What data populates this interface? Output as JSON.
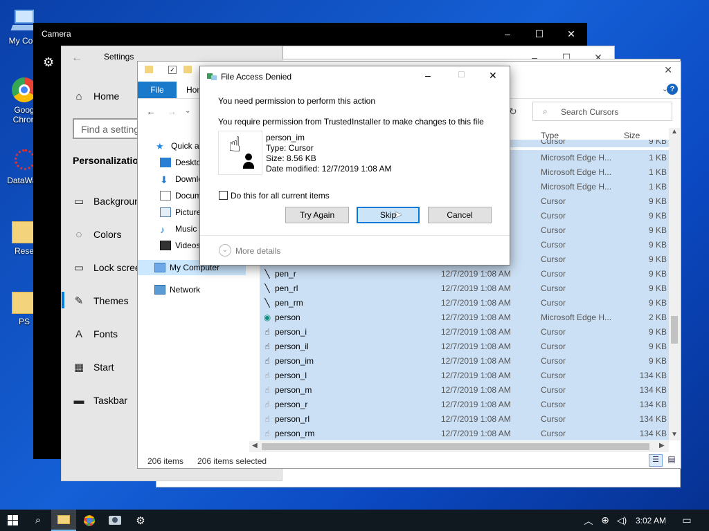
{
  "desktop": {
    "icons": [
      {
        "label": "My Com",
        "icon": "computer-icon"
      },
      {
        "label": "Goog Chron",
        "icon": "chrome-icon"
      },
      {
        "label": "DataWag",
        "icon": "datawag-icon"
      },
      {
        "label": "Rese",
        "icon": "folder-icon"
      },
      {
        "label": "PS",
        "icon": "folder-icon"
      }
    ]
  },
  "camera": {
    "title": "Camera",
    "controls": [
      "–",
      "☐",
      "✕"
    ]
  },
  "settings": {
    "title": "Settings",
    "home": "Home",
    "search_placeholder": "Find a setting",
    "section": "Personalization",
    "items": [
      "Background",
      "Colors",
      "Lock screen",
      "Themes",
      "Fonts",
      "Start",
      "Taskbar"
    ],
    "active_item": "Themes"
  },
  "explorer": {
    "ribbon_tabs": [
      "File",
      "Hom"
    ],
    "search_placeholder": "Search Cursors",
    "columns": {
      "type": "Type",
      "size": "Size"
    },
    "nav": [
      {
        "label": "Quick ac",
        "icon": "star-icon"
      },
      {
        "label": "Deskto",
        "icon": "desktop-icon"
      },
      {
        "label": "Downlo",
        "icon": "download-icon"
      },
      {
        "label": "Docum",
        "icon": "document-icon"
      },
      {
        "label": "Picture",
        "icon": "pictures-icon"
      },
      {
        "label": "Music",
        "icon": "music-icon"
      },
      {
        "label": "Videos",
        "icon": "videos-icon"
      },
      {
        "label": "My Computer",
        "icon": "computer-icon"
      },
      {
        "label": "Network",
        "icon": "network-icon"
      }
    ],
    "partial_rows": [
      {
        "type": "Cursor",
        "size": "9 KB"
      },
      {
        "type": "Microsoft Edge H...",
        "size": "1 KB"
      },
      {
        "type": "Microsoft Edge H...",
        "size": "1 KB"
      },
      {
        "type": "Microsoft Edge H...",
        "size": "1 KB"
      },
      {
        "type": "Cursor",
        "size": "9 KB"
      },
      {
        "type": "Cursor",
        "size": "9 KB"
      },
      {
        "type": "Cursor",
        "size": "9 KB"
      },
      {
        "type": "Cursor",
        "size": "9 KB"
      },
      {
        "type": "Cursor",
        "size": "9 KB"
      }
    ],
    "rows": [
      {
        "name": "pen_r",
        "date": "12/7/2019 1:08 AM",
        "type": "Cursor",
        "size": "9 KB",
        "glyph": "╲"
      },
      {
        "name": "pen_rl",
        "date": "12/7/2019 1:08 AM",
        "type": "Cursor",
        "size": "9 KB",
        "glyph": "╲"
      },
      {
        "name": "pen_rm",
        "date": "12/7/2019 1:08 AM",
        "type": "Cursor",
        "size": "9 KB",
        "glyph": "╲"
      },
      {
        "name": "person",
        "date": "12/7/2019 1:08 AM",
        "type": "Microsoft Edge H...",
        "size": "2 KB",
        "glyph": "◉"
      },
      {
        "name": "person_i",
        "date": "12/7/2019 1:08 AM",
        "type": "Cursor",
        "size": "9 KB",
        "glyph": "☝"
      },
      {
        "name": "person_il",
        "date": "12/7/2019 1:08 AM",
        "type": "Cursor",
        "size": "9 KB",
        "glyph": "☝"
      },
      {
        "name": "person_im",
        "date": "12/7/2019 1:08 AM",
        "type": "Cursor",
        "size": "9 KB",
        "glyph": "☝"
      },
      {
        "name": "person_l",
        "date": "12/7/2019 1:08 AM",
        "type": "Cursor",
        "size": "134 KB",
        "glyph": "☝"
      },
      {
        "name": "person_m",
        "date": "12/7/2019 1:08 AM",
        "type": "Cursor",
        "size": "134 KB",
        "glyph": "☝"
      },
      {
        "name": "person_r",
        "date": "12/7/2019 1:08 AM",
        "type": "Cursor",
        "size": "134 KB",
        "glyph": "☝"
      },
      {
        "name": "person_rl",
        "date": "12/7/2019 1:08 AM",
        "type": "Cursor",
        "size": "134 KB",
        "glyph": "☝"
      },
      {
        "name": "person_rm",
        "date": "12/7/2019 1:08 AM",
        "type": "Cursor",
        "size": "134 KB",
        "glyph": "☝"
      }
    ],
    "status": {
      "items": "206 items",
      "selected": "206 items selected"
    }
  },
  "dialog": {
    "title": "File Access Denied",
    "heading": "You need permission to perform this action",
    "message": "You require permission from TrustedInstaller to make changes to this file",
    "file": {
      "name": "person_im",
      "type": "Type: Cursor",
      "size": "Size: 8.56 KB",
      "modified": "Date modified: 12/7/2019 1:08 AM"
    },
    "checkbox_label": "Do this for all current items",
    "buttons": {
      "try_again": "Try Again",
      "skip": "Skip",
      "cancel": "Cancel"
    },
    "more_details": "More details"
  },
  "taskbar": {
    "time": "3:02 AM",
    "apps": [
      "start-icon",
      "search-icon",
      "file-explorer-icon",
      "chrome-icon",
      "camera-icon",
      "settings-icon"
    ]
  },
  "colors": {
    "accent": "#0078d7",
    "selection": "#cce0f5",
    "taskbar": "#101820"
  }
}
